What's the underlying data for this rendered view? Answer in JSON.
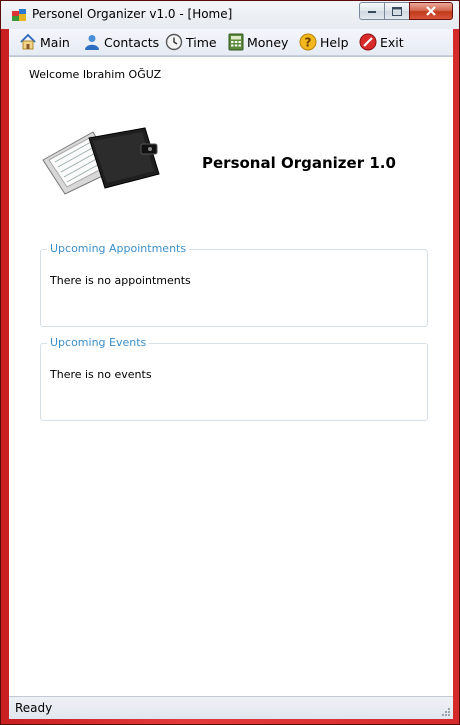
{
  "window": {
    "title": "Personel Organizer v1.0 - [Home]"
  },
  "menu": {
    "items": [
      {
        "label": "Main",
        "icon": "home-icon"
      },
      {
        "label": "Contacts",
        "icon": "contacts-icon"
      },
      {
        "label": "Time",
        "icon": "clock-icon"
      },
      {
        "label": "Money",
        "icon": "calculator-icon"
      },
      {
        "label": "Help",
        "icon": "help-icon"
      },
      {
        "label": "Exit",
        "icon": "exit-icon"
      }
    ]
  },
  "home": {
    "welcome": "Welcome Ibrahim OĞUZ",
    "app_name": "Personal Organizer 1.0",
    "appointments": {
      "legend": "Upcoming Appointments",
      "text": "There is no appointments"
    },
    "events": {
      "legend": "Upcoming Events",
      "text": "There is no events"
    }
  },
  "status": {
    "text": "Ready"
  }
}
